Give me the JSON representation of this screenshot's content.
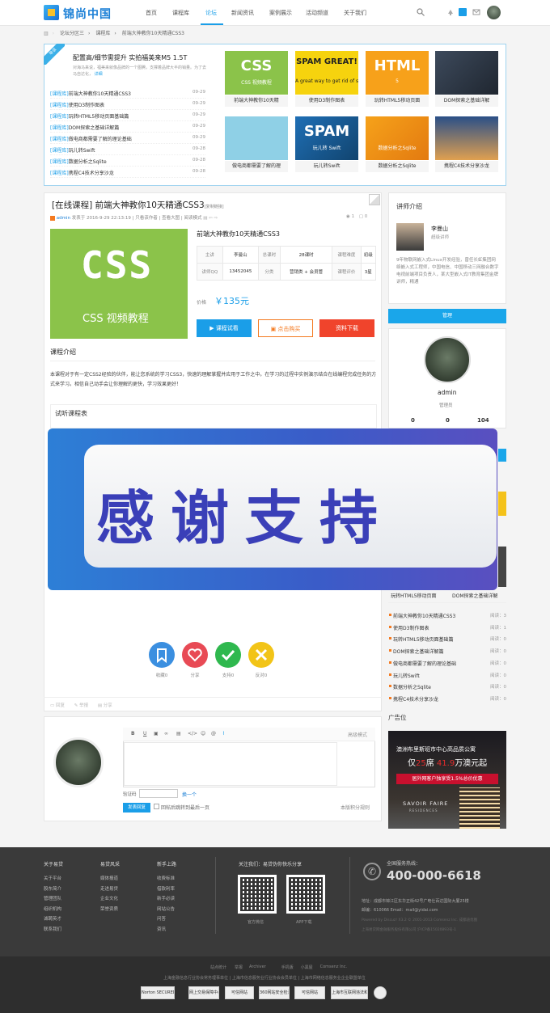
{
  "header": {
    "logo_text": "锦尚中国",
    "nav": [
      "首页",
      "课程库",
      "论坛",
      "新闻资讯",
      "案例展示",
      "活动频道",
      "关于我们"
    ],
    "active_nav": "论坛"
  },
  "breadcrumb": [
    "论坛分区三",
    "›",
    "课程库",
    "›",
    "前端大神教你10天精通CSS3"
  ],
  "top": {
    "ribbon": "导读",
    "featured_title": "配置高/细节需提升 实拍福美来M5 1.5T",
    "featured_desc": "对海马来说，福美来就像品牌的一个图腾，支撑着品牌大半的销量。为了去马自达化，",
    "featured_more": "详细",
    "news": [
      {
        "tag": "[课程库]",
        "title": "前端大神教你10天精通CSS3",
        "date": "09-29"
      },
      {
        "tag": "[课程库]",
        "title": "使用D3制作图表",
        "date": "09-29"
      },
      {
        "tag": "[课程库]",
        "title": "玩转HTML5移动页面基础篇",
        "date": "09-29"
      },
      {
        "tag": "[课程库]",
        "title": "DOM探索之基础详解篇",
        "date": "09-29"
      },
      {
        "tag": "[课程库]",
        "title": "做电商都需要了解的理论基础",
        "date": "09-29"
      },
      {
        "tag": "[课程库]",
        "title": "玩儿转Swift",
        "date": "09-28"
      },
      {
        "tag": "[课程库]",
        "title": "数据分析之Sqlite",
        "date": "09-28"
      },
      {
        "tag": "[课程库]",
        "title": "携程C4技术分享沙龙",
        "date": "09-28"
      }
    ],
    "thumbs": [
      {
        "caption": "前端大神教你10天精",
        "img_text": "CSS",
        "img_sub": "CSS 视频教程"
      },
      {
        "caption": "使用D3制作图表",
        "img_text": "SPAM GREAT!",
        "img_sub": "A great way to get rid of spam!"
      },
      {
        "caption": "玩转HTML5移动页面",
        "img_text": "HTML",
        "img_sub": "5"
      },
      {
        "caption": "DOM探索之基础详解",
        "img_text": "",
        "img_sub": ""
      },
      {
        "caption": "做电商都需要了解的理",
        "img_text": "",
        "img_sub": ""
      },
      {
        "caption": "玩儿转Swift",
        "img_text": "SPAM",
        "img_sub": "玩儿转 Swift"
      },
      {
        "caption": "数据分析之Sqlite",
        "img_text": "",
        "img_sub": "数据分析之Sqlite"
      },
      {
        "caption": "携程C4技术分享沙龙",
        "img_text": "",
        "img_sub": ""
      }
    ]
  },
  "course": {
    "title": "[在线课程] 前端大神教你10天精通CSS3",
    "copy_link": "[复制链接]",
    "meta_author": "admin",
    "meta_rest": "发表于 2016-9-29 22:13:19 | 只看该作者 | 查看大图 | 阅读模式",
    "views": "1",
    "replies": "0",
    "img_big": "CSS",
    "img_sub": "CSS 视频教程",
    "name": "前端大神教你10天精通CSS3",
    "table": [
      [
        "主讲",
        "李曼山",
        "总课时",
        "28课时",
        "课程难度",
        "初级"
      ],
      [
        "讲师QQ",
        "13452045",
        "分类",
        "营销类 + 会员管",
        "课程评价",
        "3星"
      ]
    ],
    "price_label": "价格",
    "price": "￥135元",
    "btn_try": "课程试看",
    "btn_buy": "点击购买",
    "btn_download": "资料下载",
    "intro_title": "课程介绍",
    "intro_text": "本课程对于有一定CSS2经验的伙伴，能让您系统的学习CSS3，快速的理解掌握并应用于工作之中。在学习的过程中实例演示结合在线编程完成任务的方式来学习。相信自己动手会让你理解的更快，学习效果更好！",
    "trial_title": "试听课程表"
  },
  "banner_text": "感谢支持",
  "actions": [
    {
      "label": "收藏",
      "count": "0",
      "color": "#3b8fe0"
    },
    {
      "label": "分享",
      "count": "",
      "color": "#e84a55"
    },
    {
      "label": "支持",
      "count": "0",
      "color": "#2fb84e"
    },
    {
      "label": "反对",
      "count": "0",
      "color": "#f2c417"
    }
  ],
  "post_tools": [
    "回复",
    "举报",
    "分享"
  ],
  "reply": {
    "tools": [
      "B",
      "U",
      "",
      "",
      "",
      "",
      "@",
      ""
    ],
    "advanced": "高级模式",
    "captcha_label": "验证码",
    "captcha_change": "换一个",
    "submit": "发表回复",
    "checkbox": "回帖后跳转到最后一页",
    "rule": "本版积分规则"
  },
  "side": {
    "teacher_title": "讲师介绍",
    "teacher_name": "李曼山",
    "teacher_role": "超级讲师",
    "teacher_desc": "9年物联网嵌入式Linux开发经验，曾任长虹集团网络嵌入式工程师，中国电信、中国移动三网融合数字电视前端项目负责人，某大型嵌入式IT教育集团金牌讲师，精通",
    "manage": "管理",
    "admin_name": "admin",
    "admin_role": "管理员",
    "stats": [
      "0",
      "0",
      "104"
    ],
    "partial_captions": [
      "玩转HTML5移动页面",
      "DOM探索之基础详解"
    ],
    "list": [
      {
        "title": "前端大神教你10天精通CSS3",
        "views": "阅读：3"
      },
      {
        "title": "使用D3制作图表",
        "views": "阅读：1"
      },
      {
        "title": "玩转HTML5移动页面基础篇",
        "views": "阅读：0"
      },
      {
        "title": "DOM探索之基础详解篇",
        "views": "阅读：0"
      },
      {
        "title": "做电商都需要了解的理论基础",
        "views": "阅读：0"
      },
      {
        "title": "玩儿转Swift",
        "views": "阅读：0"
      },
      {
        "title": "数据分析之Sqlite",
        "views": "阅读：0"
      },
      {
        "title": "携程C4技术分享沙龙",
        "views": "阅读：0"
      }
    ],
    "ad_title": "广告位",
    "ad_line1": "澳洲布里斯班市中心高品质公寓",
    "ad_line2a": "仅",
    "ad_line2b": "25",
    "ad_line2c": "席",
    "ad_line2d": "41.9",
    "ad_line2e": "万澳元起",
    "ad_line3": "居外网客户独享受1.5%总价优惠",
    "ad_brand": "SAVOIR FAIRE",
    "ad_brand_sub": "RESIDENCES"
  },
  "footer": {
    "cols": [
      {
        "title": "关于易贷",
        "items": [
          "关于平台",
          "股东简介",
          "管理团队",
          "组织机构",
          "诚聘英才",
          "联系我们"
        ]
      },
      {
        "title": "易贷风采",
        "items": [
          "媒体报道",
          "走进易贷",
          "企业文化",
          "荣誉资质"
        ]
      },
      {
        "title": "新手上路",
        "items": [
          "收费标准",
          "借款利率",
          "新手必读",
          "网站公告",
          "问答",
          "资讯"
        ]
      }
    ],
    "follow": "关注我们：易贷伪你快乐分享",
    "qr1": "官方微信",
    "qr2": "APP下载",
    "hotline_label": "全国服务热线：",
    "hotline": "400-000-6618",
    "address": "地址：成都市锦江区东华正街42号广电仕百达国际大厦25楼",
    "email": "邮编：610066  Email：mail@yidai.com",
    "powered": "Powered by Discuz! X3.2 © 2001-2013 Comsenz Inc. 成都迪优图",
    "company": "上海易贷网金融服务股份有限公司 沪ICP备15020893号-1",
    "links": [
      "站点统计",
      "举报",
      "Archiver",
      "手机版",
      "小黑屋",
      "Comsenz Inc."
    ],
    "assoc": "上海金融信息行业协会常务理事单位 | 上海市信息服务业行业协会会员单位 | 上海市网络信息服务业企业联盟单位",
    "badges": [
      "Norton SECURED",
      "网上交易保障中心",
      "可信网站",
      "360网站安全检测",
      "可信网站",
      "上海市互联网违法和不良信息举报中心",
      ""
    ]
  }
}
